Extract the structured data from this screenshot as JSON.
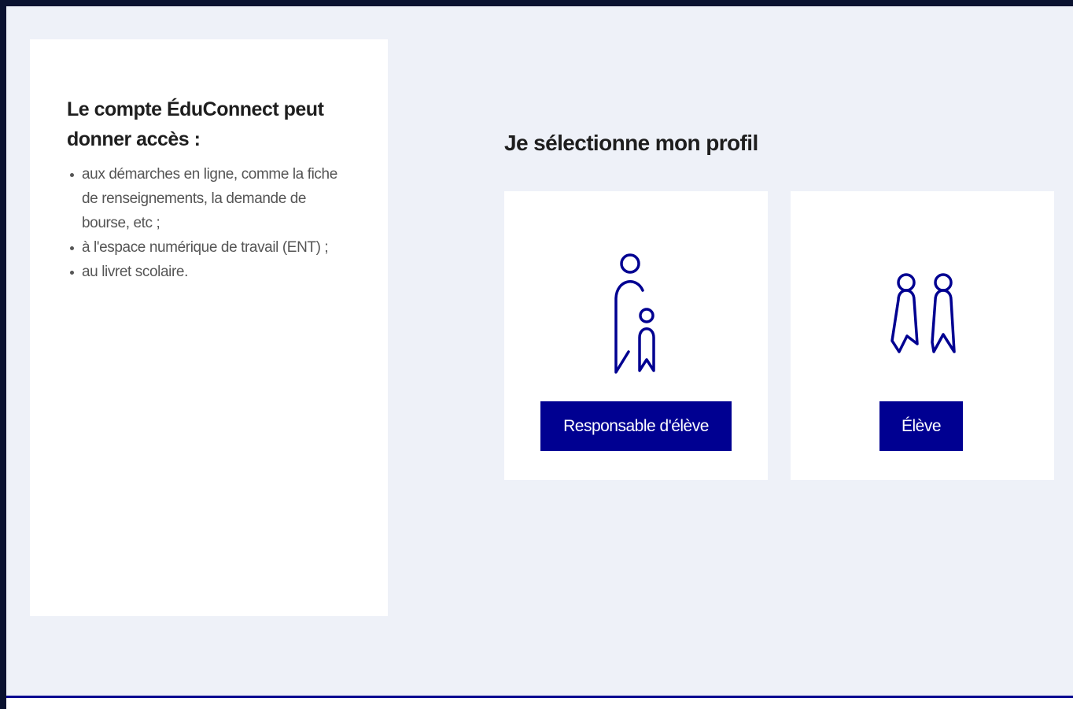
{
  "info": {
    "title": "Le compte ÉduConnect peut donner accès :",
    "items": [
      "aux démarches en ligne, comme la fiche de renseignements, la demande de bourse, etc ;",
      "à l'espace numérique de travail (ENT) ;",
      "au livret scolaire."
    ]
  },
  "profile": {
    "title": "Je sélectionne mon profil",
    "cards": [
      {
        "icon": "parent-child-icon",
        "button_label": "Responsable d'élève"
      },
      {
        "icon": "two-students-icon",
        "button_label": "Élève"
      }
    ]
  },
  "colors": {
    "accent": "#000091",
    "page_background": "#eef1f8",
    "card_background": "#ffffff",
    "outer_background": "#0a1230"
  }
}
